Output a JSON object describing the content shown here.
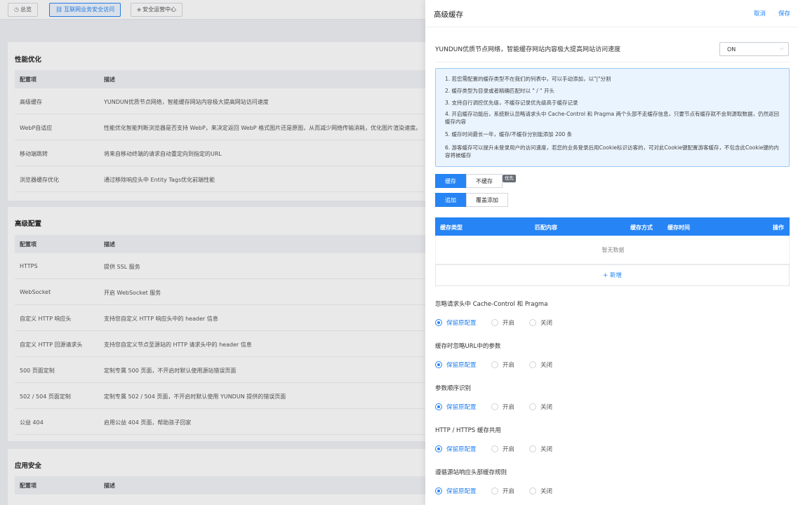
{
  "topnav": [
    {
      "label": "总览",
      "icon": "overview-icon",
      "active": false
    },
    {
      "label": "互联网业务安全访问",
      "icon": "link-icon",
      "active": true
    },
    {
      "label": "安全运营中心",
      "icon": "shield-icon",
      "active": false
    }
  ],
  "perf": {
    "title": "性能优化",
    "col1": "配置项",
    "col2": "描述",
    "rows": [
      {
        "name": "高级缓存",
        "desc": "YUNDUN优质节点网络，智能缓存网站内容极大提高网站访问速度"
      },
      {
        "name": "WebP自适应",
        "desc": "性能优化智能判断浏览器是否支持 WebP，来决定返回 WebP 格式图片还是原图，从而减少网络传输消耗，优化图片渲染速度。"
      },
      {
        "name": "移动端跳转",
        "desc": "将来自移动终端的请求自动重定向到指定的URL"
      },
      {
        "name": "浏览器缓存优化",
        "desc": "通过移除响应头中 Entity Tags优化前端性能"
      }
    ]
  },
  "adv": {
    "title": "高级配置",
    "col1": "配置项",
    "col2": "描述",
    "rows": [
      {
        "name": "HTTPS",
        "desc": "提供 SSL 服务"
      },
      {
        "name": "WebSocket",
        "desc": "开启 WebSocket 服务"
      },
      {
        "name": "自定义 HTTP 响应头",
        "desc": "支持您自定义 HTTP 响应头中的 header 信息"
      },
      {
        "name": "自定义 HTTP 回源请求头",
        "desc": "支持您自定义节点至源站的 HTTP 请求头中的 header 信息"
      },
      {
        "name": "500 页面定制",
        "desc": "定制专属 500 页面，不开启时默认使用源站错误页面"
      },
      {
        "name": "502 / 504 页面定制",
        "desc": "定制专属 502 / 504 页面，不开启时默认使用 YUNDUN 提供的错误页面"
      },
      {
        "name": "公益 404",
        "desc": "启用公益 404 页面，帮助孩子回家"
      }
    ]
  },
  "appsec": {
    "title": "应用安全",
    "col1": "配置项",
    "col2": "描述"
  },
  "drawer": {
    "title": "高级缓存",
    "cancel": "取消",
    "save": "保存",
    "desc": "YUNDUN优质节点网络，智能缓存网站内容极大提高网站访问速度",
    "select_value": "ON",
    "notices": [
      "1. 若您需配置的缓存类型不在我们的列表中，可以手动添加，以\"|\"分割",
      "2. 缓存类型为目录或者精确匹配时以 \" / \" 开头",
      "3. 支持自行调控优先级，不缓存记录优先级高于缓存记录",
      "4. 开启缓存功能后，系统默认忽略请求头中 Cache-Control 和 Pragma 两个头部不走缓存信息，只要节点有缓存就不会到源取数据，仍然返回缓存内容",
      "5. 缓存时间最长一年，缓存/不缓存分别能添加 200 条",
      "6. 游客缓存可以提升未登录用户的访问速度，若您的业务登录后用Cookie标识访客的，可对此Cookie键配置游客缓存，不包含此Cookie键的内容将被缓存"
    ],
    "tab_cache": "缓存",
    "tab_nocache": "不缓存",
    "priority_badge": "优先",
    "btn_append": "追加",
    "btn_overwrite": "覆盖添加",
    "table": {
      "headers": [
        "缓存类型",
        "匹配内容",
        "缓存方式",
        "缓存时间",
        "操作"
      ],
      "empty": "暂无数据"
    },
    "add": "+ 新增",
    "options": [
      {
        "label": "忽略请求头中 Cache-Control 和 Pragma",
        "selected": 0
      },
      {
        "label": "缓存时忽略URL中的参数",
        "selected": 0
      },
      {
        "label": "参数顺序识别",
        "selected": 0
      },
      {
        "label": "HTTP / HTTPS 缓存共用",
        "selected": 0
      },
      {
        "label": "遵循源站响应头部缓存规则",
        "selected": 0
      }
    ],
    "radio_labels": [
      "保留原配置",
      "开启",
      "关闭"
    ]
  }
}
